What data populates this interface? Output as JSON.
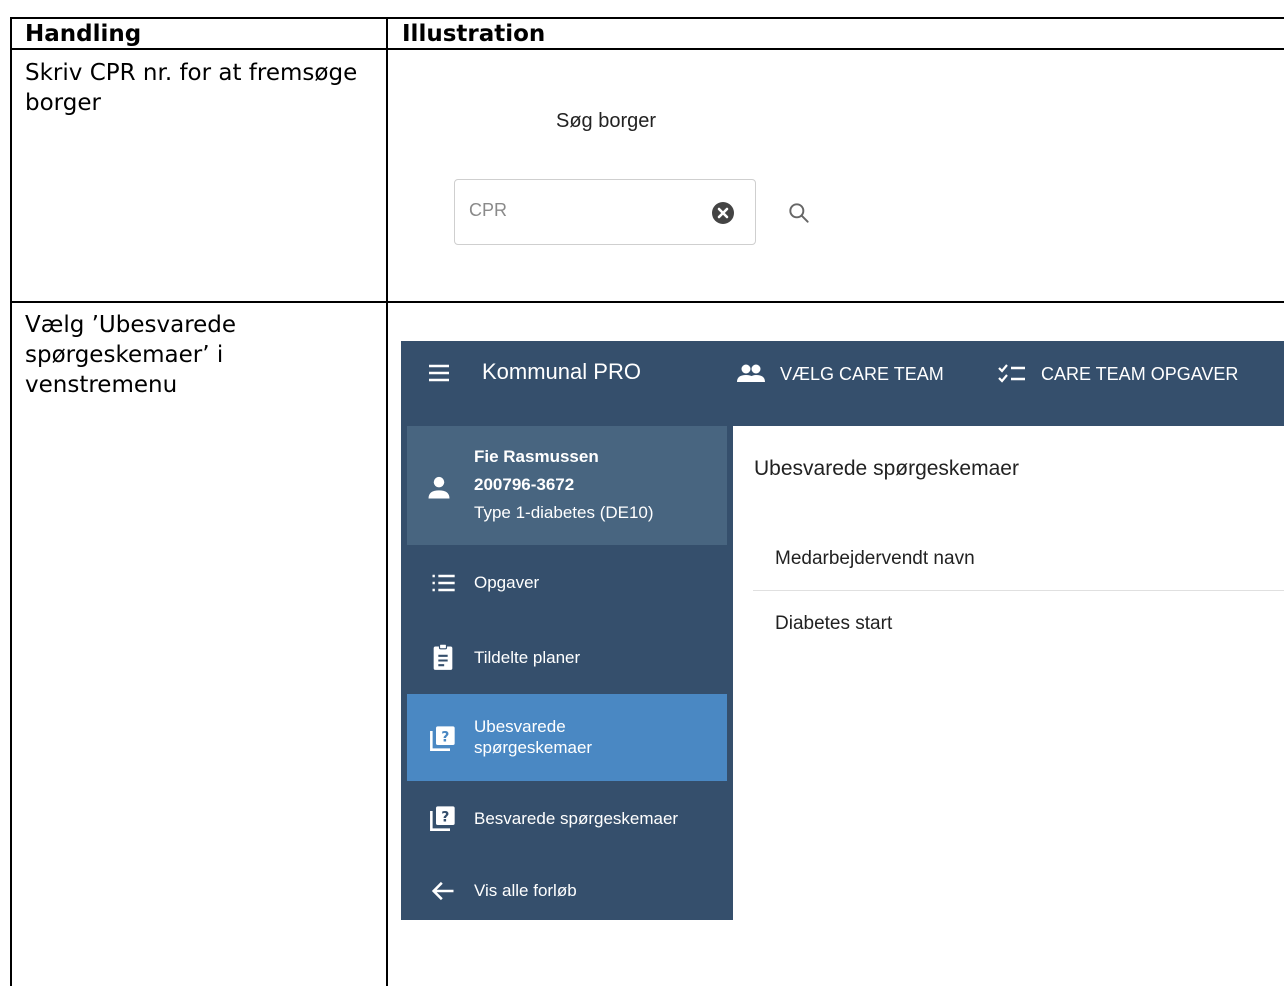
{
  "table": {
    "header_handling": "Handling",
    "header_illustration": "Illustration",
    "rows": [
      {
        "handling": "Skriv CPR nr. for at fremsøge borger"
      },
      {
        "handling": "Vælg ’Ubesvarede spørgeskemaer’ i venstremenu"
      }
    ]
  },
  "search": {
    "title": "Søg borger",
    "placeholder": "CPR",
    "value": "",
    "clear_icon": "clear-circle-icon",
    "search_icon": "search-icon"
  },
  "app": {
    "title": "Kommunal PRO",
    "nav": [
      {
        "label": "VÆLG CARE TEAM",
        "icon": "group-icon"
      },
      {
        "label": "CARE TEAM OPGAVER",
        "icon": "checklist-icon"
      }
    ],
    "patient": {
      "name": "Fie Rasmussen",
      "cpr": "200796-3672",
      "condition": "Type 1-diabetes (DE10)"
    },
    "sidebar": [
      {
        "label": "Opgaver",
        "icon": "list-icon",
        "active": false
      },
      {
        "label": "Tildelte planer",
        "icon": "clipboard-icon",
        "active": false
      },
      {
        "label": "Ubesvarede spørgeskemaer",
        "icon": "quiz-icon",
        "active": true
      },
      {
        "label": "Besvarede spørgeskemaer",
        "icon": "quiz-icon",
        "active": false
      },
      {
        "label": "Vis alle forløb",
        "icon": "arrow-back-icon",
        "active": false
      }
    ],
    "content": {
      "title": "Ubesvarede spørgeskemaer",
      "column_header": "Medarbejdervendt navn",
      "items": [
        "Diabetes start"
      ]
    }
  },
  "colors": {
    "appbar": "#354f6c",
    "patient_panel": "#486580",
    "active_item": "#4a88c3"
  }
}
